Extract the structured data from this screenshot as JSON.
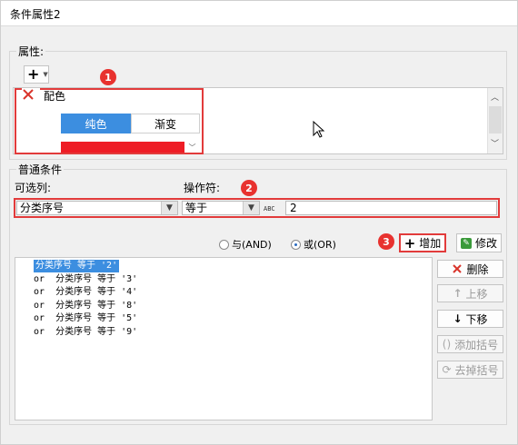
{
  "window": {
    "title": "条件属性2"
  },
  "attributes": {
    "group_label": "属性:",
    "add_symbol": "+",
    "item_label": "配色",
    "tabs": [
      "纯色",
      "渐变"
    ],
    "selected_tab": "纯色",
    "swatch_color": "#ee1c25"
  },
  "condition": {
    "group_label": "普通条件",
    "column_label": "可选列:",
    "operator_label": "操作符:",
    "column_value": "分类序号",
    "operator_value": "等于",
    "abc_icon": "ABC",
    "input_value": "2",
    "radio_and": "与(AND)",
    "radio_or": "或(OR)",
    "radio_selected": "or",
    "add_button": "增加",
    "modify_button": "修改",
    "list": [
      "分类序号 等于 '2'",
      "or  分类序号 等于 '3'",
      "or  分类序号 等于 '4'",
      "or  分类序号 等于 '8'",
      "or  分类序号 等于 '5'",
      "or  分类序号 等于 '9'"
    ],
    "side_buttons": {
      "delete": "删除",
      "up": "上移",
      "down": "下移",
      "add_bracket": "添加括号",
      "remove_bracket": "去掉括号"
    }
  },
  "markers": [
    "1",
    "2",
    "3"
  ]
}
